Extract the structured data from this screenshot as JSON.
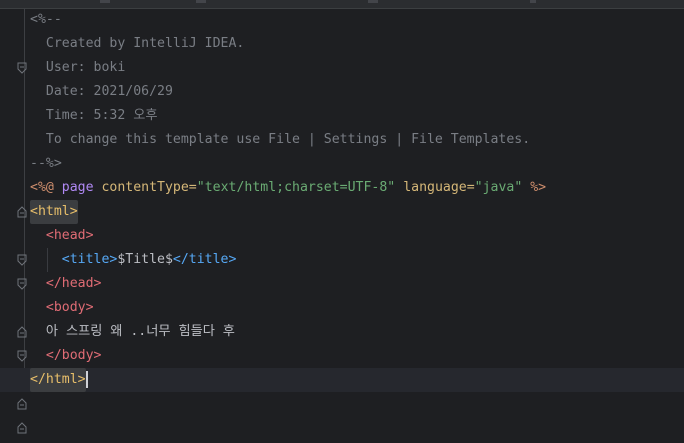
{
  "editor": {
    "lines": [
      {
        "id": "l1",
        "segments": [
          {
            "cls": "c-comment",
            "text": "<%--"
          }
        ]
      },
      {
        "id": "l2",
        "segments": [
          {
            "cls": "c-comment",
            "text": "  Created by IntelliJ IDEA."
          }
        ]
      },
      {
        "id": "l3",
        "segments": [
          {
            "cls": "c-comment",
            "text": "  User: boki"
          }
        ]
      },
      {
        "id": "l4",
        "segments": [
          {
            "cls": "c-comment",
            "text": "  Date: 2021/06/29"
          }
        ]
      },
      {
        "id": "l5",
        "segments": [
          {
            "cls": "c-comment",
            "text": "  Time: 5:32 오후"
          }
        ]
      },
      {
        "id": "l6",
        "segments": [
          {
            "cls": "c-comment",
            "text": "  To change this template use File | Settings | File Templates."
          }
        ]
      },
      {
        "id": "l7",
        "segments": [
          {
            "cls": "c-comment",
            "text": "--%>"
          }
        ]
      },
      {
        "id": "l8",
        "segments": [
          {
            "cls": "c-dir",
            "text": "<%@ "
          },
          {
            "cls": "c-page",
            "text": "page "
          },
          {
            "cls": "c-jspattr",
            "text": "contentType="
          },
          {
            "cls": "c-str",
            "text": "\"text/html;charset=UTF-8\" "
          },
          {
            "cls": "c-jspattr",
            "text": "language="
          },
          {
            "cls": "c-str",
            "text": "\"java\" "
          },
          {
            "cls": "c-dir",
            "text": "%>"
          }
        ]
      },
      {
        "id": "l9",
        "segments": [
          {
            "cls": "c-html",
            "text": "<html>"
          }
        ]
      },
      {
        "id": "l10",
        "segments": [
          {
            "cls": "c-head",
            "text": "  <head>"
          }
        ]
      },
      {
        "id": "l11",
        "segments": [
          {
            "cls": "c-title",
            "text": "    <title>"
          },
          {
            "cls": "c-text",
            "text": "$Title$"
          },
          {
            "cls": "c-title",
            "text": "</title>"
          }
        ]
      },
      {
        "id": "l12",
        "segments": [
          {
            "cls": "c-head",
            "text": "  </head>"
          }
        ]
      },
      {
        "id": "l13",
        "segments": [
          {
            "cls": "c-head",
            "text": "  <body>"
          }
        ]
      },
      {
        "id": "l14",
        "segments": [
          {
            "cls": "c-text",
            "text": "  아 스프링 왜 ..너무 힘들다 후"
          }
        ]
      },
      {
        "id": "l15",
        "segments": [
          {
            "cls": "c-head",
            "text": "  </body>"
          }
        ]
      },
      {
        "id": "l16",
        "segments": [
          {
            "cls": "c-html",
            "text": "</html>"
          }
        ]
      }
    ]
  },
  "icons": {
    "fold": "fold-marker-icon",
    "intention": "lightbulb-icon"
  },
  "colors": {
    "background": "#1e1f22",
    "comment": "#7a7e85",
    "string": "#6aab73",
    "html_tag": "#e8bf6a",
    "head_tag": "#e06c75",
    "title_tag": "#56a8f5",
    "page_keyword": "#b189f5"
  }
}
